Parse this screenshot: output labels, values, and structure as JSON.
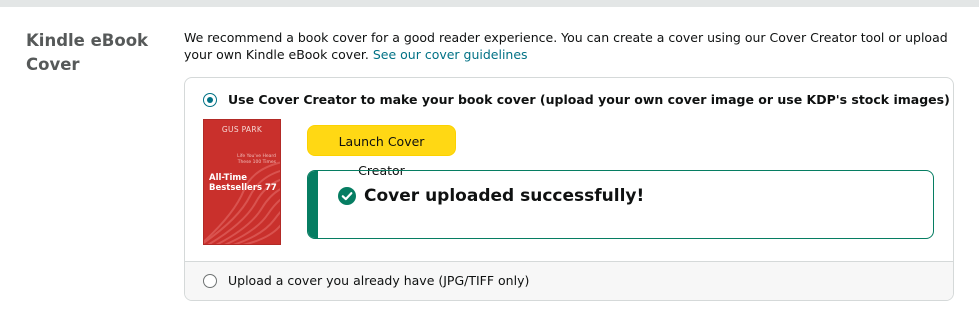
{
  "section": {
    "title": "Kindle eBook Cover",
    "description": "We recommend a book cover for a good reader experience. You can create a cover using our Cover Creator tool or upload your own Kindle eBook cover.",
    "guidelines_link": "See our cover guidelines"
  },
  "option_cover_creator": {
    "label": "Use Cover Creator to make your book cover (upload your own cover image or use KDP's stock images)",
    "selected": true,
    "cover_preview": {
      "author": "GUS PARK",
      "subtitle": "Life You've Heard These 100 Times",
      "title": "All-Time Bestsellers 77",
      "color": "#c9302c"
    },
    "launch_button": "Launch Cover Creator",
    "success_message": "Cover uploaded successfully!"
  },
  "option_upload": {
    "label": "Upload a cover you already have (JPG/TIFF only)",
    "selected": false
  },
  "colors": {
    "accent": "#007185",
    "button": "#ffd814",
    "success": "#067d62"
  }
}
